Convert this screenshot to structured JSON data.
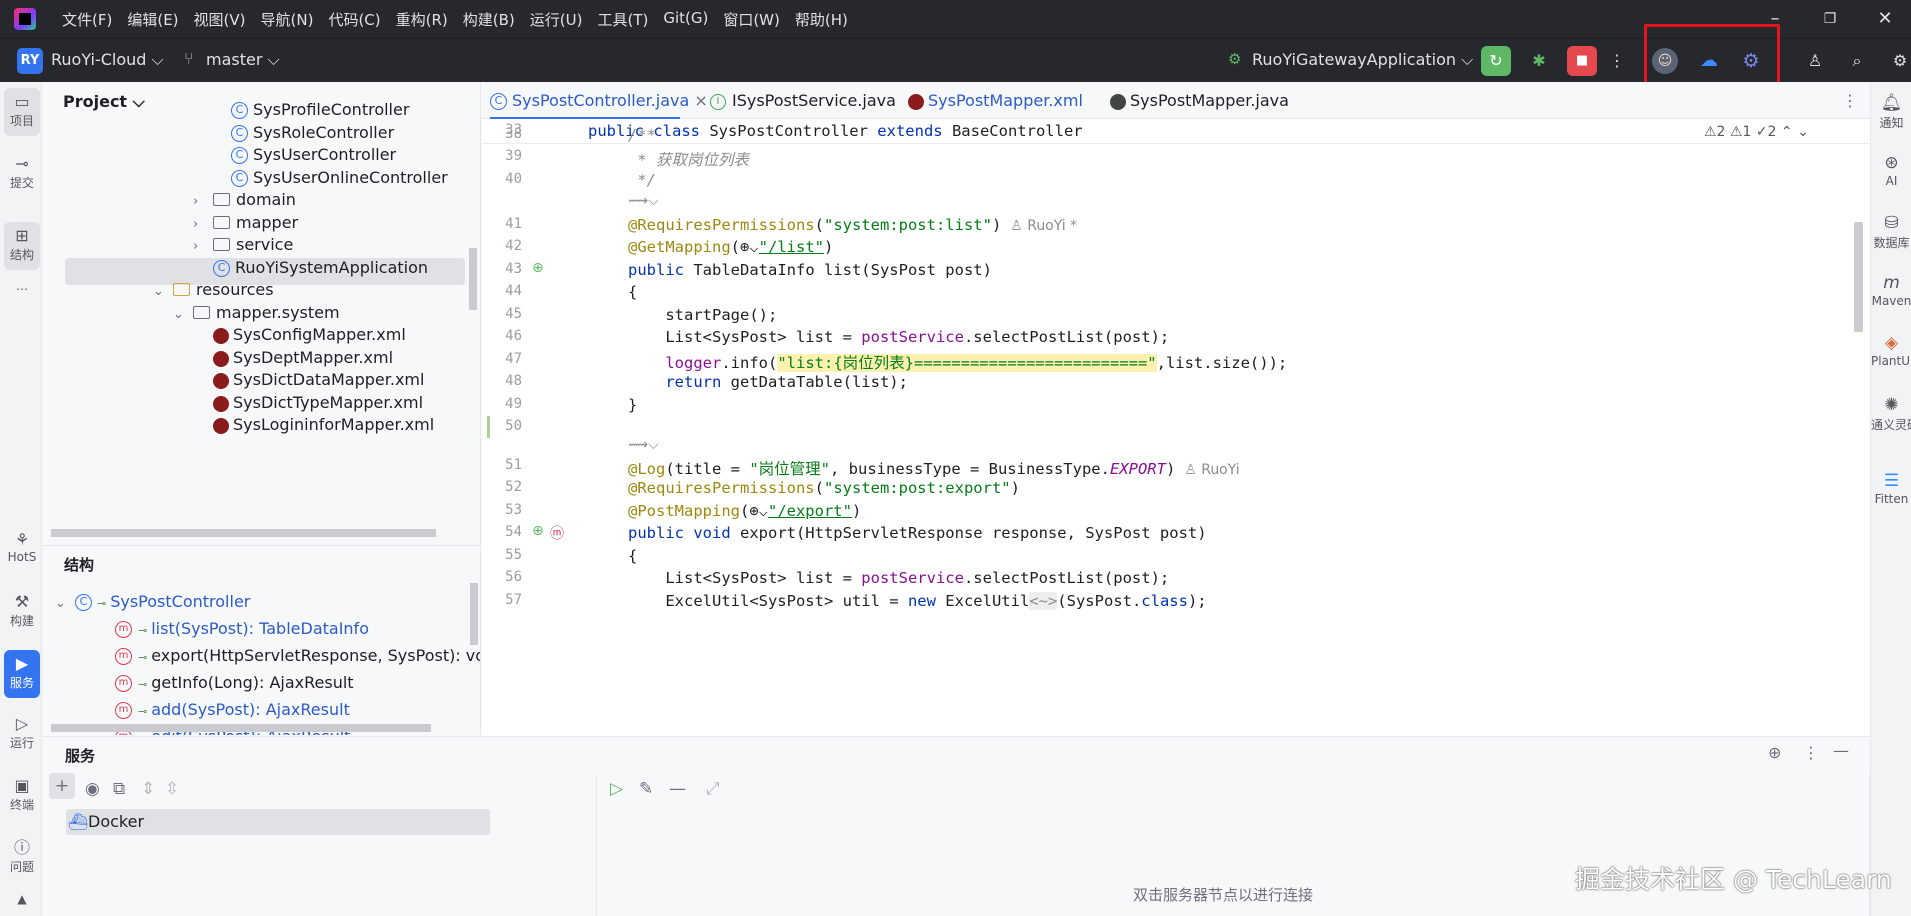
{
  "menu": [
    "文件(F)",
    "编辑(E)",
    "视图(V)",
    "导航(N)",
    "代码(C)",
    "重构(R)",
    "构建(B)",
    "运行(U)",
    "工具(T)",
    "Git(G)",
    "窗口(W)",
    "帮助(H)"
  ],
  "toolbar": {
    "project_badge": "RY",
    "project_name": "RuoYi-Cloud ⌵",
    "branch": "master ⌵",
    "run_config": "RuoYiGatewayApplication ⌵"
  },
  "left_strip": [
    {
      "label": "项目",
      "icon": "folder-icon"
    },
    {
      "label": "提交",
      "icon": "commit-icon"
    },
    {
      "label": "结构",
      "icon": "structure-icon"
    },
    {
      "label": "HotS",
      "icon": "hotswap-icon"
    },
    {
      "label": "构建",
      "icon": "build-icon"
    },
    {
      "label": "服务",
      "icon": "services-icon"
    },
    {
      "label": "运行",
      "icon": "run-icon"
    },
    {
      "label": "终端",
      "icon": "terminal-icon"
    },
    {
      "label": "问题",
      "icon": "problems-icon"
    }
  ],
  "right_strip": [
    {
      "label": "通知",
      "icon": "bell-icon"
    },
    {
      "label": "AI",
      "icon": "ai-icon"
    },
    {
      "label": "数据库",
      "icon": "database-icon"
    },
    {
      "label": "Maven",
      "icon": "maven-icon"
    },
    {
      "label": "PlantUML",
      "icon": "plantuml-icon"
    },
    {
      "label": "通义灵码",
      "icon": "tongyi-icon"
    },
    {
      "label": "Fitten",
      "icon": "fitten-icon"
    }
  ],
  "project_panel": {
    "title": "Project ⌵",
    "items": [
      {
        "label": "SysProfileController",
        "kind": "class"
      },
      {
        "label": "SysRoleController",
        "kind": "class"
      },
      {
        "label": "SysUserController",
        "kind": "class"
      },
      {
        "label": "SysUserOnlineController",
        "kind": "class"
      },
      {
        "label": "domain",
        "kind": "folder"
      },
      {
        "label": "mapper",
        "kind": "folder"
      },
      {
        "label": "service",
        "kind": "folder"
      },
      {
        "label": "RuoYiSystemApplication",
        "kind": "app"
      },
      {
        "label": "resources",
        "kind": "folder"
      },
      {
        "label": "mapper.system",
        "kind": "folder"
      },
      {
        "label": "SysConfigMapper.xml",
        "kind": "xml"
      },
      {
        "label": "SysDeptMapper.xml",
        "kind": "xml"
      },
      {
        "label": "SysDictDataMapper.xml",
        "kind": "xml"
      },
      {
        "label": "SysDictTypeMapper.xml",
        "kind": "xml"
      },
      {
        "label": "SysLogininforMapper.xml",
        "kind": "xml"
      }
    ]
  },
  "structure_panel": {
    "title": "结构",
    "root": "SysPostController",
    "members": [
      "list(SysPost): TableDataInfo",
      "export(HttpServletResponse, SysPost): void",
      "getInfo(Long): AjaxResult",
      "add(SysPost): AjaxResult",
      "edit(SysPost): AjaxResult"
    ]
  },
  "tabs": [
    {
      "label": "SysPostController.java",
      "close": "×"
    },
    {
      "label": "ISysPostService.java"
    },
    {
      "label": "SysPostMapper.xml"
    },
    {
      "label": "SysPostMapper.java"
    }
  ],
  "editor": {
    "sticky_line_no": "33",
    "sticky": {
      "k1": "public class",
      "name": " SysPostController ",
      "k2": "extends",
      "base": " BaseController"
    },
    "inspections": "⚠2  ⚠1  ✓2  ⌃  ⌄",
    "lines": {
      "l38": {
        "no": "38",
        "t": "/**"
      },
      "l39": {
        "no": "39",
        "t": " * 获取岗位列表"
      },
      "l40": {
        "no": "40",
        "t": " */"
      },
      "hint1": "⟿⌵",
      "l41": {
        "no": "41",
        "ann": "@RequiresPermissions",
        "open": "(",
        "str": "\"system:post:list\"",
        "close": ")",
        "author": "  ♙ RuoYi *"
      },
      "l42": {
        "no": "42",
        "ann": "@GetMapping",
        "open": "(⊕⌵",
        "str": "\"/list\"",
        "close": ")"
      },
      "l43": {
        "no": "43",
        "kw": "public",
        "rest": " TableDataInfo list(SysPost post)"
      },
      "l44": {
        "no": "44",
        "t": "{"
      },
      "l45": {
        "no": "45",
        "t": "    startPage();"
      },
      "l46": {
        "no": "46",
        "a": "    List<SysPost> list = ",
        "fld": "postService",
        "b": ".selectPostList(post);"
      },
      "l47": {
        "no": "47",
        "fld": "    logger",
        "a": ".info(",
        "str": "\"list:{岗位列表}=========================\"",
        "b": ",list.size());"
      },
      "l48": {
        "no": "48",
        "kw": "    return",
        "rest": " getDataTable(list);"
      },
      "l49": {
        "no": "49",
        "t": "}"
      },
      "l50": {
        "no": "50",
        "t": ""
      },
      "hint2": "⟿⌵",
      "l51": {
        "no": "51",
        "ann": "@Log",
        "a": "(title = ",
        "str": "\"岗位管理\"",
        "b": ", businessType = BusinessType.",
        "enum": "EXPORT",
        "c": ")",
        "author": "  ♙ RuoYi"
      },
      "l52": {
        "no": "52",
        "ann": "@RequiresPermissions",
        "open": "(",
        "str": "\"system:post:export\"",
        "close": ")"
      },
      "l53": {
        "no": "53",
        "ann": "@PostMapping",
        "open": "(⊕⌵",
        "str": "\"/export\"",
        "close": ")"
      },
      "l54": {
        "no": "54",
        "kw": "public void",
        "rest": " export(HttpServletResponse response, SysPost post)"
      },
      "l55": {
        "no": "55",
        "t": "{"
      },
      "l56": {
        "no": "56",
        "a": "    List<SysPost> list = ",
        "fld": "postService",
        "b": ".selectPostList(post);"
      },
      "l57": {
        "no": "57",
        "a": "    ExcelUtil<SysPost> util = ",
        "kw": "new",
        "b": " ExcelUtil",
        "diamond": "<~>",
        "c": "(SysPost.",
        "kw2": "class",
        "d": ");"
      }
    }
  },
  "services": {
    "title": "服务",
    "docker": "Docker",
    "hint": "双击服务器节点以进行连接"
  },
  "watermark": "掘金技术社区 @ TechLearn",
  "colors": {
    "accent": "#3574f0",
    "highlight_box": "#e5141f",
    "run_green": "#5fb865",
    "stop_red": "#e5484d"
  }
}
